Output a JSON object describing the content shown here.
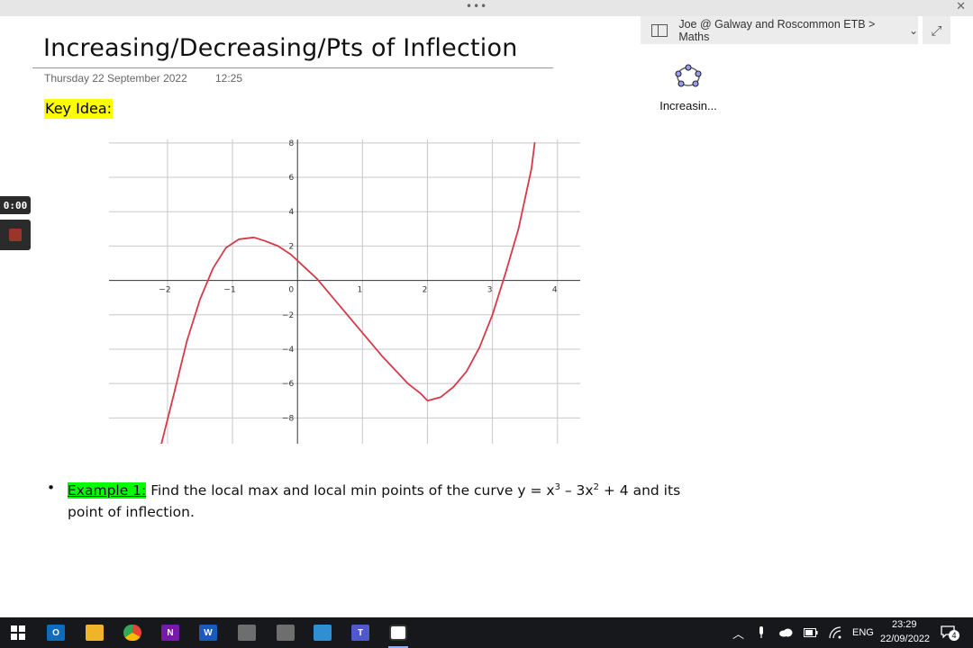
{
  "window": {
    "dots": "•••",
    "close": "✕"
  },
  "notebook": {
    "breadcrumb": "Joe @ Galway and Roscommon ETB > Maths",
    "chevron": "⌄",
    "expand": "⤢"
  },
  "page": {
    "title": "Increasing/Decreasing/Pts of Inflection",
    "date": "Thursday 22 September 2022",
    "time": "12:25",
    "key_idea": "Key Idea:"
  },
  "attachment": {
    "name": "Increasin..."
  },
  "recorder": {
    "time": "0:00"
  },
  "example": {
    "bullet": "•",
    "label": "Example 1:",
    "text_a": " Find the local max and local min points of the curve y = x",
    "sup1": "3",
    "text_b": " – 3x",
    "sup2": "2",
    "text_c": " + 4 and its point of inflection."
  },
  "chart_data": {
    "type": "line",
    "function": "y = x^3 - 3x^2 + 4 (shifted)",
    "x_ticks": [
      "−2",
      "−1",
      "0",
      "1",
      "2",
      "3",
      "4"
    ],
    "y_ticks": [
      "8",
      "6",
      "4",
      "2",
      "−2",
      "−4",
      "−6",
      "−8"
    ],
    "xlim": [
      -2.9,
      4.35
    ],
    "ylim": [
      -9.5,
      8.2
    ],
    "grid": true,
    "series": [
      {
        "color": "#d63a4a",
        "x": [
          -2.1,
          -1.9,
          -1.7,
          -1.5,
          -1.3,
          -1.1,
          -0.9,
          -0.67,
          -0.5,
          -0.3,
          -0.1,
          0.1,
          0.3,
          0.5,
          0.7,
          0.9,
          1.1,
          1.3,
          1.5,
          1.7,
          1.9,
          2.0,
          2.2,
          2.4,
          2.6,
          2.8,
          3.0,
          3.2,
          3.4,
          3.6,
          3.65
        ],
        "y": [
          -9.6,
          -6.6,
          -3.5,
          -1.1,
          0.7,
          1.9,
          2.4,
          2.5,
          2.3,
          2.0,
          1.5,
          0.8,
          0.1,
          -0.8,
          -1.7,
          -2.6,
          -3.5,
          -4.4,
          -5.2,
          -6.0,
          -6.6,
          -7.0,
          -6.8,
          -6.2,
          -5.3,
          -3.9,
          -2.0,
          0.4,
          3.0,
          6.5,
          8.0
        ]
      }
    ]
  },
  "taskbar": {
    "apps": [
      {
        "name": "outlook",
        "letter": "O",
        "color": "#0f6cbd"
      },
      {
        "name": "file-explorer",
        "letter": "",
        "color": "#f0b429"
      },
      {
        "name": "chrome",
        "letter": "",
        "color": "#34a853"
      },
      {
        "name": "onenote",
        "letter": "N",
        "color": "#7719aa"
      },
      {
        "name": "word",
        "letter": "W",
        "color": "#185abd"
      },
      {
        "name": "calculator",
        "letter": "",
        "color": "#6e6e6e"
      },
      {
        "name": "phone",
        "letter": "",
        "color": "#6e6e6e"
      },
      {
        "name": "app",
        "letter": "",
        "color": "#2f8fd0"
      },
      {
        "name": "teams",
        "letter": "T",
        "color": "#5059c9"
      },
      {
        "name": "geogebra",
        "letter": "",
        "color": "#ffffff"
      }
    ],
    "tray_chevron": "︿",
    "language": "ENG",
    "clock_time": "23:29",
    "clock_date": "22/09/2022",
    "notifications": "4"
  }
}
